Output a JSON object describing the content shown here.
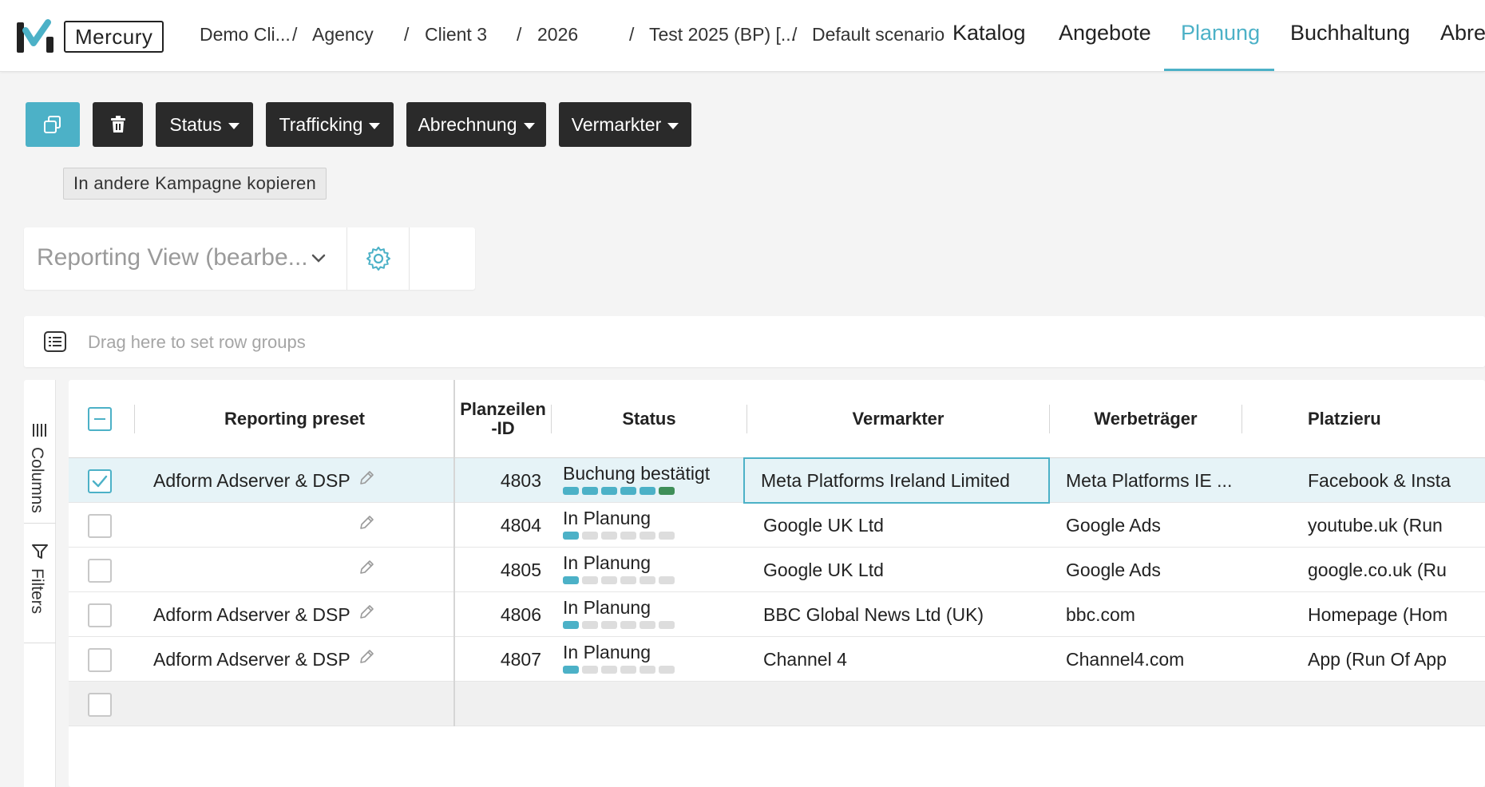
{
  "app": {
    "logo_text": "Mercury"
  },
  "breadcrumb": [
    "Demo Cli...",
    "Agency",
    "Client 3",
    "2026",
    "Test 2025 (BP) [...",
    "Default scenario"
  ],
  "nav": [
    {
      "label": "Katalog",
      "active": false
    },
    {
      "label": "Angebote",
      "active": false
    },
    {
      "label": "Planung",
      "active": true
    },
    {
      "label": "Buchhaltung",
      "active": false
    },
    {
      "label": "Abrec",
      "active": false
    }
  ],
  "toolbar": {
    "copy_icon": "copy-icon",
    "delete_icon": "trash-icon",
    "dropdowns": [
      "Status",
      "Trafficking",
      "Abrechnung",
      "Vermarkter"
    ],
    "tooltip": "In andere Kampagne kopieren"
  },
  "view": {
    "selected": "Reporting View (bearbe...",
    "settings_icon": "gear-icon"
  },
  "row_groups": {
    "placeholder": "Drag here to set row groups"
  },
  "side_panel": {
    "tabs": [
      "Columns",
      "Filters"
    ]
  },
  "grid": {
    "columns": [
      "Reporting preset",
      "Planzeilen\n-ID",
      "Status",
      "Vermarkter",
      "Werbeträger",
      "Platzieru"
    ],
    "rows": [
      {
        "selected": true,
        "preset": "Adform Adserver & DSP",
        "id": "4803",
        "status": "Buchung bestätigt",
        "progress": 6,
        "vermarkter": "Meta Platforms Ireland Limited",
        "werbetraeger": "Meta Platforms IE ...",
        "platzierung": "Facebook & Insta"
      },
      {
        "selected": false,
        "preset": "",
        "id": "4804",
        "status": "In Planung",
        "progress": 1,
        "vermarkter": "Google UK Ltd",
        "werbetraeger": "Google Ads",
        "platzierung": "youtube.uk (Run"
      },
      {
        "selected": false,
        "preset": "",
        "id": "4805",
        "status": "In Planung",
        "progress": 1,
        "vermarkter": "Google UK Ltd",
        "werbetraeger": "Google Ads",
        "platzierung": "google.co.uk (Ru"
      },
      {
        "selected": false,
        "preset": "Adform Adserver & DSP",
        "id": "4806",
        "status": "In Planung",
        "progress": 1,
        "vermarkter": "BBC Global News Ltd (UK)",
        "werbetraeger": "bbc.com",
        "platzierung": "Homepage (Hom"
      },
      {
        "selected": false,
        "preset": "Adform Adserver & DSP",
        "id": "4807",
        "status": "In Planung",
        "progress": 1,
        "vermarkter": "Channel 4",
        "werbetraeger": "Channel4.com",
        "platzierung": "App (Run Of App"
      }
    ],
    "status_segments": 6
  },
  "colors": {
    "accent": "#4cb1c7",
    "dark_button": "#2a2a2a",
    "done": "#3f8f59"
  }
}
